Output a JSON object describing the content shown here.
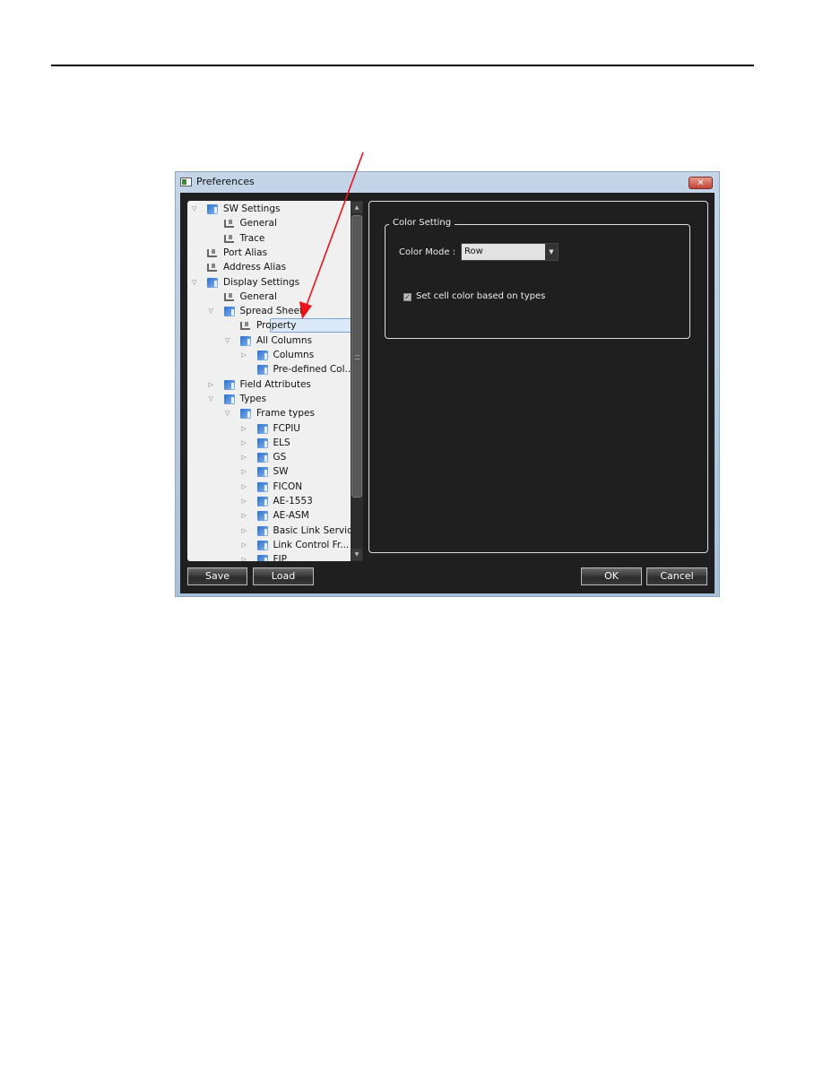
{
  "window": {
    "title": "Preferences",
    "close_label": "✕"
  },
  "tree": {
    "items": [
      {
        "label": "SW Settings",
        "expander": "▽",
        "icon": "folder-icon"
      },
      {
        "label": "General",
        "expander": "",
        "icon": "leaf-icon"
      },
      {
        "label": "Trace",
        "expander": "",
        "icon": "leaf-icon"
      },
      {
        "label": "Port Alias",
        "expander": "",
        "icon": "leaf-icon"
      },
      {
        "label": "Address Alias",
        "expander": "",
        "icon": "leaf-icon"
      },
      {
        "label": "Display Settings",
        "expander": "▽",
        "icon": "folder-icon"
      },
      {
        "label": "General",
        "expander": "",
        "icon": "leaf-icon"
      },
      {
        "label": "Spread Sheet",
        "expander": "▽",
        "icon": "folder-icon"
      },
      {
        "label": "Property",
        "expander": "",
        "icon": "leaf-icon",
        "selected": true
      },
      {
        "label": "All Columns",
        "expander": "▽",
        "icon": "folder-icon"
      },
      {
        "label": "Columns",
        "expander": "▷",
        "icon": "folder-icon"
      },
      {
        "label": "Pre-defined Col...",
        "expander": "",
        "icon": "folder-icon"
      },
      {
        "label": "Field Attributes",
        "expander": "▷",
        "icon": "folder-icon"
      },
      {
        "label": "Types",
        "expander": "▽",
        "icon": "folder-icon"
      },
      {
        "label": "Frame types",
        "expander": "▽",
        "icon": "folder-icon"
      },
      {
        "label": "FCPIU",
        "expander": "▷",
        "icon": "folder-icon"
      },
      {
        "label": "ELS",
        "expander": "▷",
        "icon": "folder-icon"
      },
      {
        "label": "GS",
        "expander": "▷",
        "icon": "folder-icon"
      },
      {
        "label": "SW",
        "expander": "▷",
        "icon": "folder-icon"
      },
      {
        "label": "FICON",
        "expander": "▷",
        "icon": "folder-icon"
      },
      {
        "label": "AE-1553",
        "expander": "▷",
        "icon": "folder-icon"
      },
      {
        "label": "AE-ASM",
        "expander": "▷",
        "icon": "folder-icon"
      },
      {
        "label": "Basic Link Service",
        "expander": "▷",
        "icon": "folder-icon"
      },
      {
        "label": "Link Control Fr...",
        "expander": "▷",
        "icon": "folder-icon"
      },
      {
        "label": "FIP",
        "expander": "▷",
        "icon": "folder-icon"
      }
    ],
    "scroll_up": "▲",
    "scroll_down": "▼"
  },
  "panel": {
    "group_title": "Color Setting",
    "color_mode_label": "Color Mode :",
    "color_mode_value": "Row",
    "dropdown_arrow": "▼",
    "checkbox_label": "Set cell color based on types",
    "checkbox_checked": true,
    "checkbox_mark": "✓"
  },
  "buttons": {
    "save": "Save",
    "load": "Load",
    "ok": "OK",
    "cancel": "Cancel"
  },
  "annotation": {
    "arrow_color": "#e8141c"
  }
}
